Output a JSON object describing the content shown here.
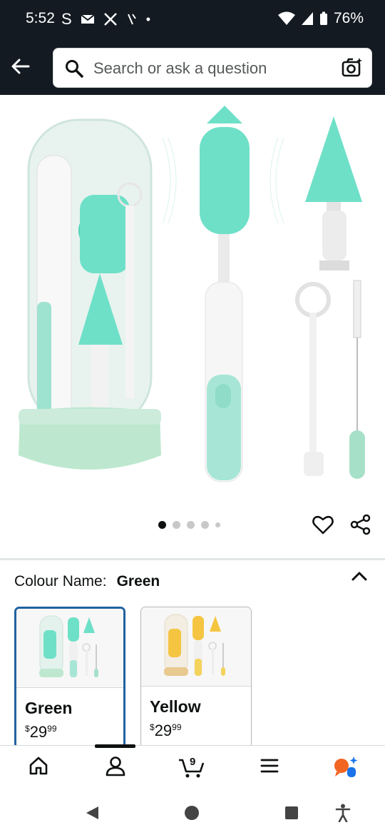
{
  "status_bar": {
    "time": "5:52",
    "carrier_glyph": "S",
    "battery": "76%"
  },
  "search": {
    "placeholder": "Search or ask a question"
  },
  "gallery": {
    "dot_count": 5,
    "active_index": 0
  },
  "colour": {
    "label": "Colour Name:",
    "selected": "Green"
  },
  "swatches": [
    {
      "name": "Green",
      "currency": "$",
      "price_main": "29",
      "price_cents": "99",
      "selected": true
    },
    {
      "name": "Yellow",
      "currency": "$",
      "price_main": "29",
      "price_cents": "99",
      "selected": false
    }
  ],
  "bottom_nav": {
    "cart_count": "9"
  },
  "colors": {
    "header_bg": "#131a22",
    "accent_teal": "#6fe0c8",
    "selected_border": "#2162a1"
  },
  "icons": [
    "back-arrow-icon",
    "search-icon",
    "camera-icon",
    "heart-icon",
    "share-icon",
    "chevron-up-icon",
    "home-icon",
    "account-icon",
    "cart-icon",
    "menu-icon",
    "ai-assistant-icon"
  ]
}
